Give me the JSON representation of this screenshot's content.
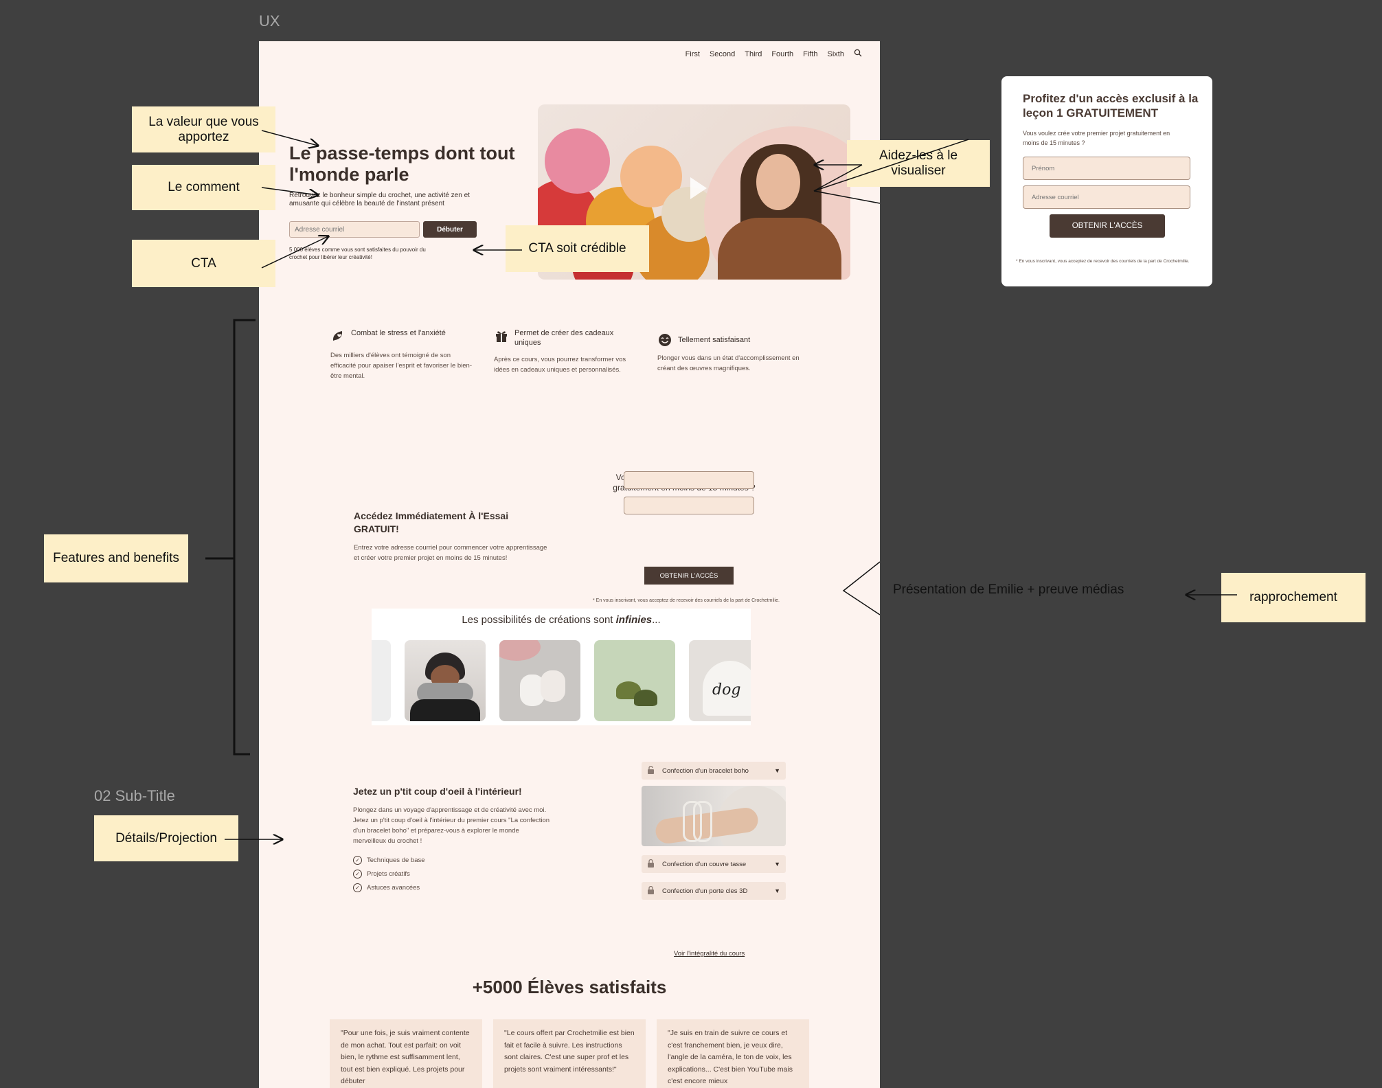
{
  "canvas_label": "UX",
  "subtitle_label": "02 Sub-Title",
  "nav": {
    "items": [
      "First",
      "Second",
      "Third",
      "Fourth",
      "Fifth",
      "Sixth"
    ],
    "search_icon": "search-icon"
  },
  "hero": {
    "title": "Le passe-temps dont tout l'monde parle",
    "subtitle": "Retrouvez le bonheur simple du crochet, une activité zen et amusante qui célèbre la beauté de l'instant présent",
    "email_placeholder": "Adresse courriel",
    "cta_label": "Débuter",
    "note": "5 000 élèves comme vous sont satisfaites du pouvoir du crochet pour libérer leur créativité!"
  },
  "features": [
    {
      "icon": "leaf-heart-icon",
      "title": "Combat le stress et l'anxiété",
      "desc": "Des milliers d'élèves ont témoigné de son efficacité pour apaiser l'esprit et favoriser le bien-être mental."
    },
    {
      "icon": "gift-icon",
      "title": "Permet de créer des cadeaux uniques",
      "desc": "Après ce cours, vous pourrez transformer vos idées en cadeaux uniques et personnalisés."
    },
    {
      "icon": "smile-icon",
      "title": "Tellement satisfaisant",
      "desc": "Plonger vous dans un état d'accomplissement en créant des œuvres magnifiques."
    }
  ],
  "trial": {
    "title": "Accédez Immédiatement À l'Essai GRATUIT!",
    "desc": "Entrez votre adresse courriel pour commencer votre apprentissage et créer votre premier projet en moins de 15 minutes!",
    "question": "Vous voulez crée votre premier projet gratuitement en moins de 15 minutes ?",
    "button": "OBTENIR L'ACCÈS",
    "note": "* En vous inscrivant, vous acceptez de recevoir des courriels de la part de Crochetmilie."
  },
  "gallery": {
    "title_prefix": "Les possibilités de créations sont ",
    "title_emph": "infinies",
    "title_suffix": "..."
  },
  "details": {
    "title": "Jetez un p'tit coup d'oeil à l'intérieur!",
    "desc": "Plongez dans un voyage d'apprentissage et de créativité avec moi. Jetez un p'tit coup d'oeil à l'intérieur du premier cours \"La confection d'un bracelet boho\" et préparez-vous à explorer le monde merveilleux du crochet !",
    "checks": [
      "Techniques de base",
      "Projets créatifs",
      "Astuces avancées"
    ],
    "accordion": [
      "Confection d'un bracelet boho",
      "Confection d'un couvre tasse",
      "Confection d'un porte cles 3D"
    ],
    "link": "Voir l'intégralité du cours"
  },
  "satisfied": {
    "title": "+5000 Élèves satisfaits"
  },
  "testimonials": [
    "\"Pour une fois, je suis vraiment contente de mon achat. Tout est parfait: on voit bien, le rythme est suffisamment lent, tout est bien expliqué. Les projets pour débuter",
    "\"Le cours offert par Crochetmilie est bien fait et facile à suivre. Les instructions sont claires. C'est une super prof et les projets sont vraiment intéressants!\"",
    "\"Je suis en train de suivre ce cours et c'est franchement bien, je veux dire, l'angle de la caméra, le ton de voix, les explications... C'est bien YouTube mais c'est encore mieux"
  ],
  "form_card": {
    "title": "Profitez d'un accès exclusif à la leçon 1 GRATUITEMENT",
    "sub": "Vous voulez crée votre premier projet gratuitement en moins de 15 minutes ?",
    "first_name_placeholder": "Prénom",
    "email_placeholder": "Adresse courriel",
    "button": "OBTENIR L'ACCÈS",
    "note": "* En vous inscrivant, vous acceptez de recevoir des courriels de la part de Crochetmilie."
  },
  "annotations": {
    "value": "La valeur que vous apportez",
    "how": "Le comment",
    "cta": "CTA",
    "cta_credible": "CTA soit crédible",
    "visualize": "Aidez-les à le visualiser",
    "features": "Features and benefits",
    "presentation": "Présentation de Emilie + preuve médias",
    "rapprochement": "rapprochement",
    "details": "Détails/Projection"
  },
  "colors": {
    "page_bg": "#fdf3ef",
    "dark_brown": "#4a3a33",
    "note_yellow": "#fdefc8",
    "canvas": "#404040"
  }
}
